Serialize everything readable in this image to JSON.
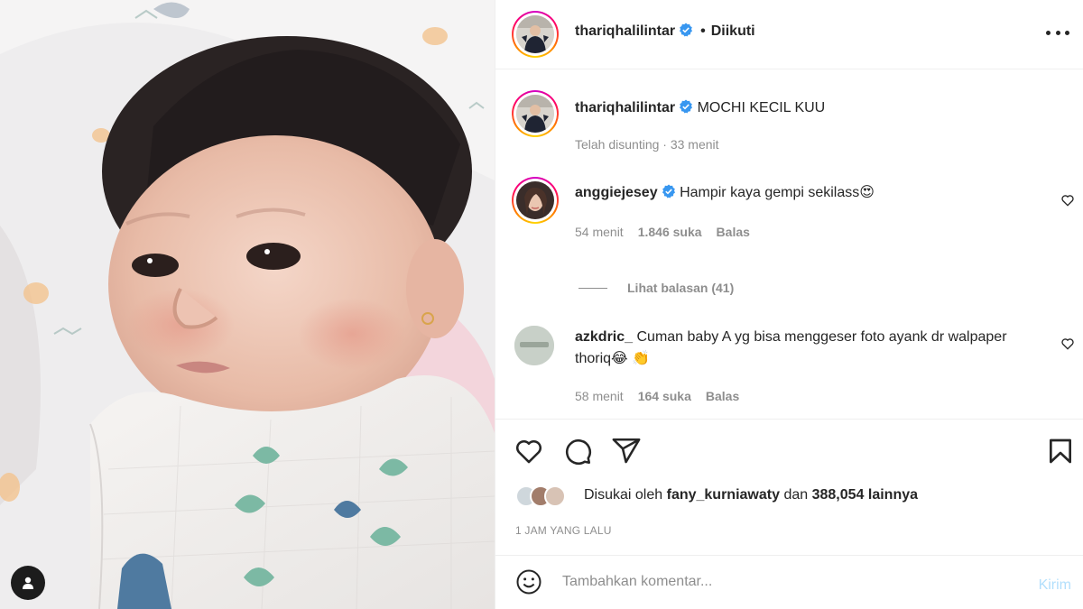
{
  "post": {
    "author": "thariqhalilintar",
    "follow_separator": "•",
    "follow_state": "Diikuti",
    "caption": "MOCHI KECIL KUU",
    "caption_meta": "Telah disunting · 33 menit"
  },
  "comments": [
    {
      "username": "anggiejesey",
      "verified": true,
      "text": "Hampir kaya gempi sekilass😍",
      "time": "54 menit",
      "likes": "1.846 suka",
      "reply": "Balas",
      "view_replies": "Lihat balasan (41)"
    },
    {
      "username": "azkdric_",
      "verified": false,
      "text": "Cuman baby A yg bisa menggeser foto ayank dr walpaper thoriq😂 👏",
      "time": "58 menit",
      "likes": "164 suka",
      "reply": "Balas"
    }
  ],
  "likes": {
    "prefix": "Disukai oleh",
    "user": "fany_kurniawaty",
    "middle": "dan",
    "count": "388,054 lainnya"
  },
  "timestamp": "1 JAM YANG LALU",
  "add_comment": {
    "placeholder": "Tambahkan komentar...",
    "post_label": "Kirim"
  },
  "icons": {
    "verified": "verified-badge-icon",
    "more": "more-options-icon",
    "like": "heart-icon",
    "comment": "comment-bubble-icon",
    "share": "paper-plane-icon",
    "save": "bookmark-icon",
    "emoji": "smiley-icon",
    "user_tag": "user-tag-icon"
  },
  "colors": {
    "verified": "#3897f0",
    "text_primary": "#262626",
    "text_secondary": "#8e8e8e",
    "post_disabled": "#b2dffc"
  }
}
